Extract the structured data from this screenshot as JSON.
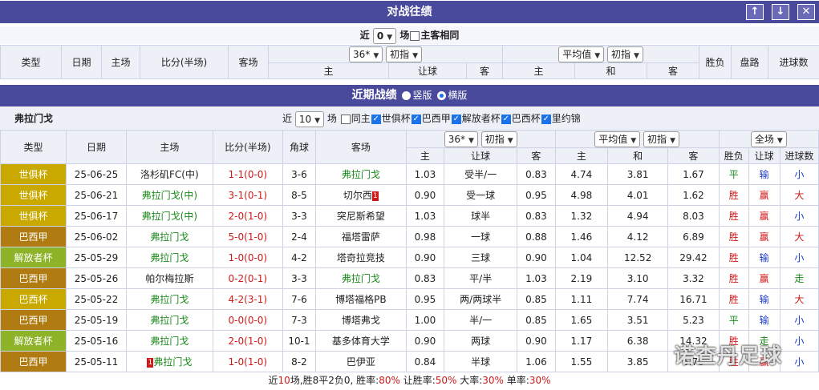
{
  "top": {
    "title": "对战往绩",
    "up": "↑",
    "down": "↓",
    "close": "✕"
  },
  "h2h": {
    "near": "近",
    "count": "0",
    "field": "场",
    "same_label": "主客相同",
    "headers": {
      "type": "类型",
      "date": "日期",
      "home": "主场",
      "score": "比分(半场)",
      "away": "客场",
      "company": "36*",
      "odds_type": "初指",
      "avg": "平均值",
      "odds_type2": "初指",
      "result": "胜负",
      "pan": "盘路",
      "goals": "进球数"
    },
    "sub": {
      "h": "主",
      "hcp": "让球",
      "a": "客",
      "h2": "主",
      "draw": "和",
      "a2": "客"
    }
  },
  "recent": {
    "title": "近期战绩",
    "opt1": "竖版",
    "opt2": "横版",
    "team": "弗拉门戈",
    "near": "近",
    "count": "10",
    "field": "场",
    "filters": [
      {
        "label": "同主",
        "on": false
      },
      {
        "label": "世俱杯",
        "on": true
      },
      {
        "label": "巴西甲",
        "on": true
      },
      {
        "label": "解放者杯",
        "on": true
      },
      {
        "label": "巴西杯",
        "on": true
      },
      {
        "label": "里约锦",
        "on": true
      }
    ],
    "headers": {
      "type": "类型",
      "date": "日期",
      "home": "主场",
      "score": "比分(半场)",
      "corner": "角球",
      "away": "客场",
      "company": "36*",
      "odds_type": "初指",
      "avg": "平均值",
      "odds_type2": "初指",
      "scope": "全场",
      "result": "胜负",
      "hcp": "让球",
      "goals": "进球数"
    },
    "sub": {
      "h": "主",
      "hcp": "让球",
      "a": "客",
      "h2": "主",
      "draw": "和",
      "a2": "客"
    },
    "rows": [
      {
        "type": "世俱杯",
        "tc": "#c9a800",
        "date": "25-06-25",
        "home": "洛杉矶FC(中)",
        "hcol": "",
        "score": "1-1(0-0)",
        "corner": "3-6",
        "away": "弗拉门戈",
        "acol": "g",
        "o1": "1.03",
        "hcp": "受半/一",
        "o2": "0.83",
        "e1": "4.74",
        "e2": "3.81",
        "e3": "1.67",
        "res": "平",
        "resc": "g",
        "pan": "输",
        "panc": "b",
        "goal": "小",
        "goalc": "b",
        "sc": "r",
        "badge": ""
      },
      {
        "type": "世俱杯",
        "tc": "#c9a800",
        "date": "25-06-21",
        "home": "弗拉门戈(中)",
        "hcol": "g",
        "score": "3-1(0-1)",
        "corner": "8-5",
        "away": "切尔西",
        "acol": "",
        "o1": "0.90",
        "hcp": "受一球",
        "o2": "0.95",
        "e1": "4.98",
        "e2": "4.01",
        "e3": "1.62",
        "res": "胜",
        "resc": "r",
        "pan": "赢",
        "panc": "r",
        "goal": "大",
        "goalc": "r",
        "sc": "r",
        "badge": "1"
      },
      {
        "type": "世俱杯",
        "tc": "#c9a800",
        "date": "25-06-17",
        "home": "弗拉门戈(中)",
        "hcol": "g",
        "score": "2-0(1-0)",
        "corner": "3-3",
        "away": "突尼斯希望",
        "acol": "",
        "o1": "1.03",
        "hcp": "球半",
        "o2": "0.83",
        "e1": "1.32",
        "e2": "4.94",
        "e3": "8.03",
        "res": "胜",
        "resc": "r",
        "pan": "赢",
        "panc": "r",
        "goal": "小",
        "goalc": "b",
        "sc": "r",
        "badge": ""
      },
      {
        "type": "巴西甲",
        "tc": "#b07b10",
        "date": "25-06-02",
        "home": "弗拉门戈",
        "hcol": "g",
        "score": "5-0(1-0)",
        "corner": "2-4",
        "away": "福塔雷萨",
        "acol": "",
        "o1": "0.98",
        "hcp": "一球",
        "o2": "0.88",
        "e1": "1.46",
        "e2": "4.12",
        "e3": "6.89",
        "res": "胜",
        "resc": "r",
        "pan": "赢",
        "panc": "r",
        "goal": "大",
        "goalc": "r",
        "sc": "r",
        "badge": ""
      },
      {
        "type": "解放者杯",
        "tc": "#8db329",
        "date": "25-05-29",
        "home": "弗拉门戈",
        "hcol": "g",
        "score": "1-0(0-0)",
        "corner": "4-2",
        "away": "塔奇拉竞技",
        "acol": "",
        "o1": "0.90",
        "hcp": "三球",
        "o2": "0.90",
        "e1": "1.04",
        "e2": "12.52",
        "e3": "29.42",
        "res": "胜",
        "resc": "r",
        "pan": "输",
        "panc": "b",
        "goal": "小",
        "goalc": "b",
        "sc": "r",
        "badge": ""
      },
      {
        "type": "巴西甲",
        "tc": "#b07b10",
        "date": "25-05-26",
        "home": "帕尔梅拉斯",
        "hcol": "",
        "score": "0-2(0-1)",
        "corner": "3-3",
        "away": "弗拉门戈",
        "acol": "g",
        "o1": "0.83",
        "hcp": "平/半",
        "o2": "1.03",
        "e1": "2.19",
        "e2": "3.10",
        "e3": "3.32",
        "res": "胜",
        "resc": "r",
        "pan": "赢",
        "panc": "r",
        "goal": "走",
        "goalc": "g",
        "sc": "r",
        "badge": ""
      },
      {
        "type": "巴西杯",
        "tc": "#c9a800",
        "date": "25-05-22",
        "home": "弗拉门戈",
        "hcol": "g",
        "score": "4-2(3-1)",
        "corner": "7-6",
        "away": "博塔福格PB",
        "acol": "",
        "o1": "0.95",
        "hcp": "两/两球半",
        "o2": "0.85",
        "e1": "1.11",
        "e2": "7.74",
        "e3": "16.71",
        "res": "胜",
        "resc": "r",
        "pan": "输",
        "panc": "b",
        "goal": "大",
        "goalc": "r",
        "sc": "r",
        "badge": ""
      },
      {
        "type": "巴西甲",
        "tc": "#b07b10",
        "date": "25-05-19",
        "home": "弗拉门戈",
        "hcol": "g",
        "score": "0-0(0-0)",
        "corner": "7-3",
        "away": "博塔弗戈",
        "acol": "",
        "o1": "1.00",
        "hcp": "半/一",
        "o2": "0.85",
        "e1": "1.65",
        "e2": "3.51",
        "e3": "5.23",
        "res": "平",
        "resc": "g",
        "pan": "输",
        "panc": "b",
        "goal": "小",
        "goalc": "b",
        "sc": "r",
        "badge": ""
      },
      {
        "type": "解放者杯",
        "tc": "#8db329",
        "date": "25-05-16",
        "home": "弗拉门戈",
        "hcol": "g",
        "score": "2-0(1-0)",
        "corner": "10-1",
        "away": "基多体育大学",
        "acol": "",
        "o1": "0.90",
        "hcp": "两球",
        "o2": "0.90",
        "e1": "1.17",
        "e2": "6.38",
        "e3": "14.32",
        "res": "胜",
        "resc": "r",
        "pan": "走",
        "panc": "g",
        "goal": "小",
        "goalc": "b",
        "sc": "r",
        "badge": ""
      },
      {
        "type": "巴西甲",
        "tc": "#b07b10",
        "date": "25-05-11",
        "home": "弗拉门戈",
        "hcol": "g",
        "score": "1-0(1-0)",
        "corner": "8-2",
        "away": "巴伊亚",
        "acol": "",
        "o1": "0.84",
        "hcp": "半球",
        "o2": "1.06",
        "e1": "1.55",
        "e2": "3.85",
        "e3": "5.78",
        "res": "胜",
        "resc": "r",
        "pan": "赢",
        "panc": "r",
        "goal": "小",
        "goalc": "b",
        "sc": "r",
        "badge": "1",
        "badge_home": true
      }
    ],
    "summary": {
      "p1": "近",
      "n": "10",
      "p2": "场,胜8平2负0, 胜率:",
      "win": "80%",
      "p3": " 让胜率:",
      "hwin": "50%",
      "p4": " 大率:",
      "big": "30%",
      "p5": " 单率:",
      "odd": "30%"
    }
  },
  "watermark": "诺查丹足球"
}
